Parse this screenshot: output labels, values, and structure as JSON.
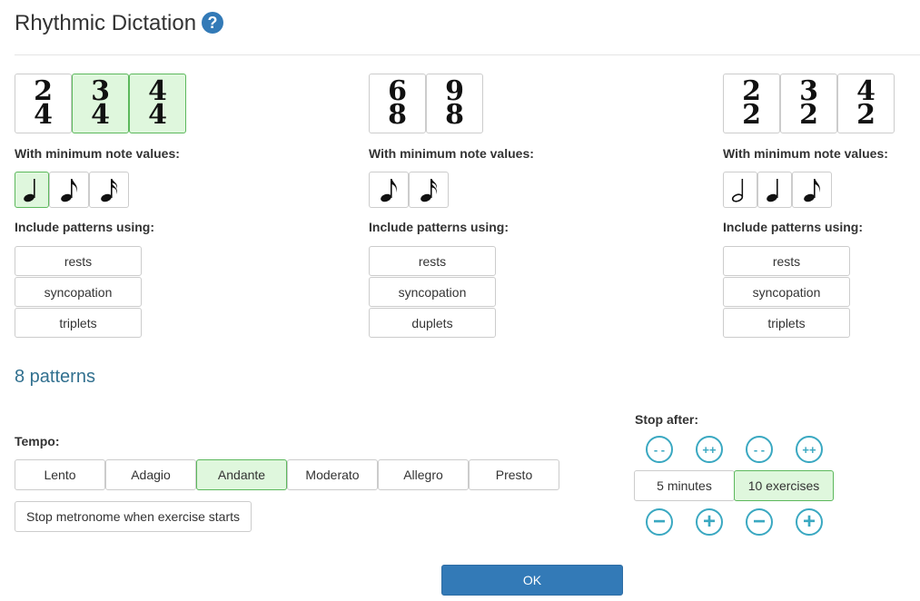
{
  "header": {
    "title": "Rhythmic Dictation",
    "help_icon": "?"
  },
  "columns": [
    {
      "time_signatures": [
        {
          "num": "2",
          "den": "4",
          "selected": false
        },
        {
          "num": "3",
          "den": "4",
          "selected": true
        },
        {
          "num": "4",
          "den": "4",
          "selected": true
        }
      ],
      "note_values_label": "With minimum note values:",
      "note_values": [
        {
          "icon": "quarter-note-icon",
          "selected": true
        },
        {
          "icon": "eighth-note-icon",
          "selected": false
        },
        {
          "icon": "sixteenth-note-icon",
          "selected": false
        }
      ],
      "patterns_label": "Include patterns using:",
      "patterns": [
        "rests",
        "syncopation",
        "triplets"
      ]
    },
    {
      "time_signatures": [
        {
          "num": "6",
          "den": "8",
          "selected": false
        },
        {
          "num": "9",
          "den": "8",
          "selected": false
        }
      ],
      "note_values_label": "With minimum note values:",
      "note_values": [
        {
          "icon": "eighth-note-icon",
          "selected": false
        },
        {
          "icon": "sixteenth-note-icon",
          "selected": false
        }
      ],
      "patterns_label": "Include patterns using:",
      "patterns": [
        "rests",
        "syncopation",
        "duplets"
      ]
    },
    {
      "time_signatures": [
        {
          "num": "2",
          "den": "2",
          "selected": false
        },
        {
          "num": "3",
          "den": "2",
          "selected": false
        },
        {
          "num": "4",
          "den": "2",
          "selected": false
        }
      ],
      "note_values_label": "With minimum note values:",
      "note_values": [
        {
          "icon": "half-note-icon",
          "selected": false
        },
        {
          "icon": "quarter-note-icon",
          "selected": false
        },
        {
          "icon": "eighth-note-icon",
          "selected": false
        }
      ],
      "patterns_label": "Include patterns using:",
      "patterns": [
        "rests",
        "syncopation",
        "triplets"
      ]
    }
  ],
  "pattern_count": "8 patterns",
  "tempo": {
    "label": "Tempo:",
    "options": [
      "Lento",
      "Adagio",
      "Andante",
      "Moderato",
      "Allegro",
      "Presto"
    ],
    "selected": "Andante"
  },
  "metronome_button": "Stop metronome when exercise starts",
  "stop_after": {
    "label": "Stop after:",
    "big_decrement": "- -",
    "big_increment": "++",
    "decrement": "−",
    "increment": "+",
    "minutes": "5 minutes",
    "exercises": "10 exercises",
    "selected": "exercises"
  },
  "ok_button": "OK",
  "colors": {
    "selected_bg": "#dff7dd",
    "selected_border": "#5cb85c",
    "primary": "#337ab7",
    "accent_circle": "#3aa8c1",
    "heading_blue": "#31708f"
  }
}
